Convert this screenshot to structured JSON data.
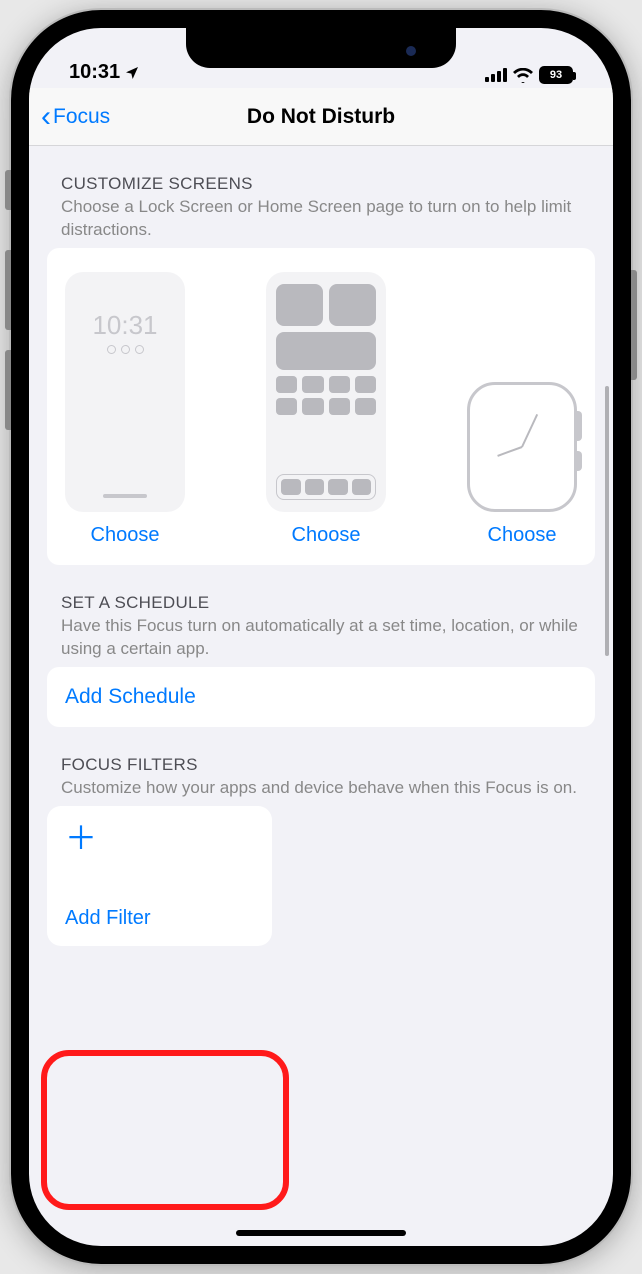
{
  "status": {
    "time": "10:31",
    "battery": "93"
  },
  "nav": {
    "back": "Focus",
    "title": "Do Not Disturb"
  },
  "customize": {
    "title": "CUSTOMIZE SCREENS",
    "desc": "Choose a Lock Screen or Home Screen page to turn on to help limit distractions.",
    "lock_time": "10:31",
    "choose1": "Choose",
    "choose2": "Choose",
    "choose3": "Choose"
  },
  "schedule": {
    "title": "SET A SCHEDULE",
    "desc": "Have this Focus turn on automatically at a set time, location, or while using a certain app.",
    "add": "Add Schedule"
  },
  "filters": {
    "title": "FOCUS FILTERS",
    "desc": "Customize how your apps and device behave when this Focus is on.",
    "add": "Add Filter"
  }
}
